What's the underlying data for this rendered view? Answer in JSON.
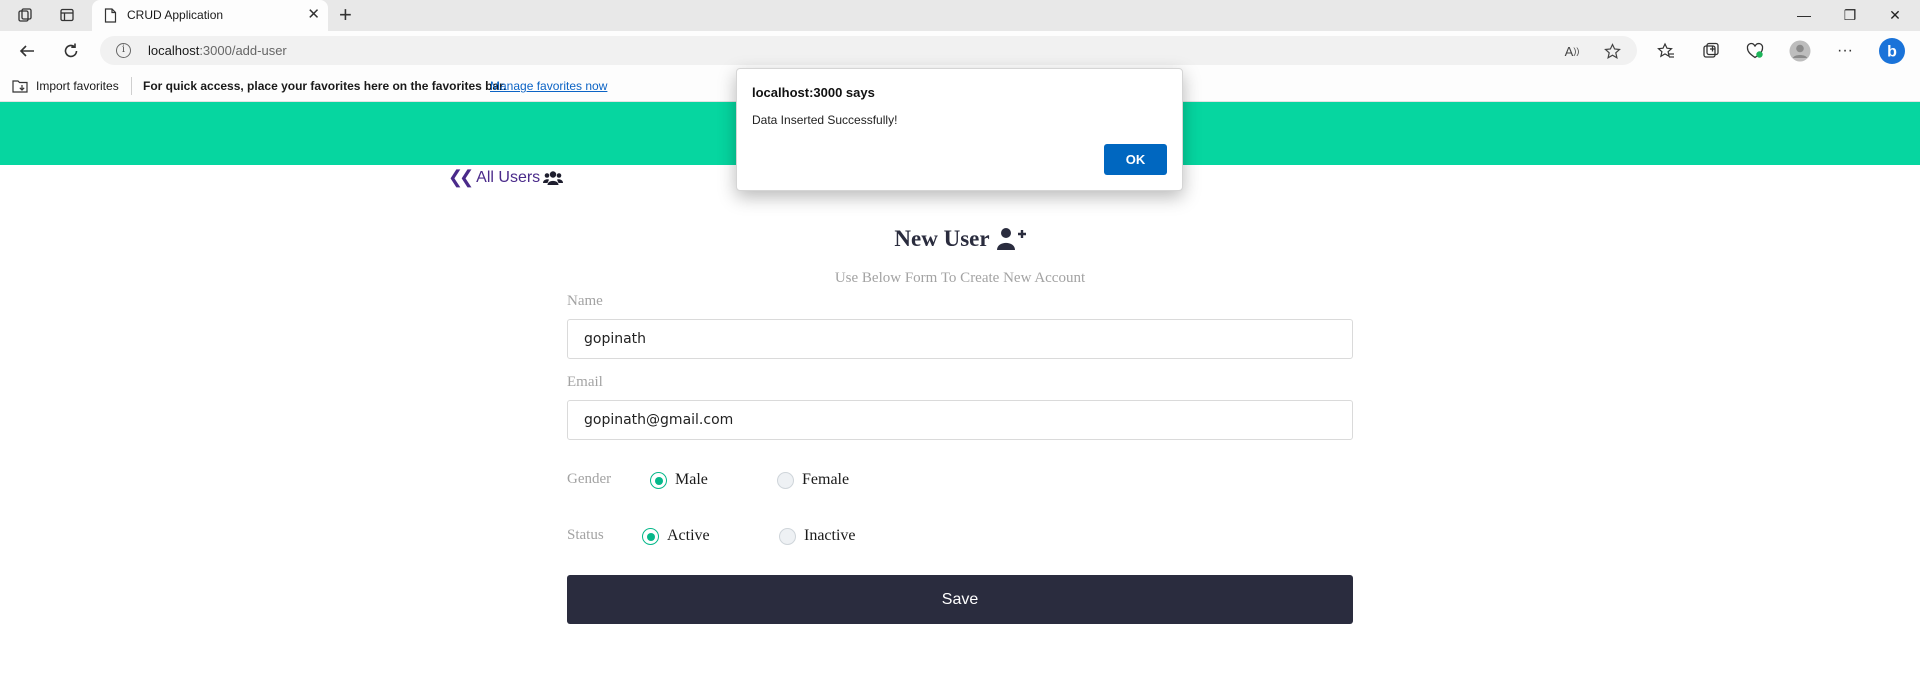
{
  "browser": {
    "tab_title": "CRUD Application",
    "url_host": "localhost",
    "url_rest": ":3000/add-user",
    "favorites": {
      "import_label": "Import favorites",
      "message": "For quick access, place your favorites here on the favorites bar.",
      "manage_link": "Manage favorites now"
    },
    "icons": [
      "workspaces-icon",
      "tab-actions-icon",
      "page-icon",
      "close-icon",
      "new-tab-icon",
      "minimize-icon",
      "restore-icon",
      "window-close-icon",
      "back-icon",
      "refresh-icon",
      "info-icon",
      "read-aloud-icon",
      "add-favorite-icon",
      "favorites-icon",
      "collections-icon",
      "browser-essentials-icon",
      "profile-icon",
      "more-icon",
      "copilot-icon"
    ]
  },
  "page": {
    "accent_color": "#06d6a0",
    "back_link": "All Users",
    "form": {
      "title": "New User",
      "subtitle": "Use Below Form To Create New Account",
      "name_label": "Name",
      "name_value": "gopinath",
      "email_label": "Email",
      "email_value": "gopinath@gmail.com",
      "gender_label": "Gender",
      "gender_options": [
        "Male",
        "Female"
      ],
      "gender_selected": "Male",
      "status_label": "Status",
      "status_options": [
        "Active",
        "Inactive"
      ],
      "status_selected": "Active",
      "save_label": "Save"
    }
  },
  "dialog": {
    "title": "localhost:3000 says",
    "message": "Data Inserted Successfully!",
    "ok_label": "OK"
  }
}
